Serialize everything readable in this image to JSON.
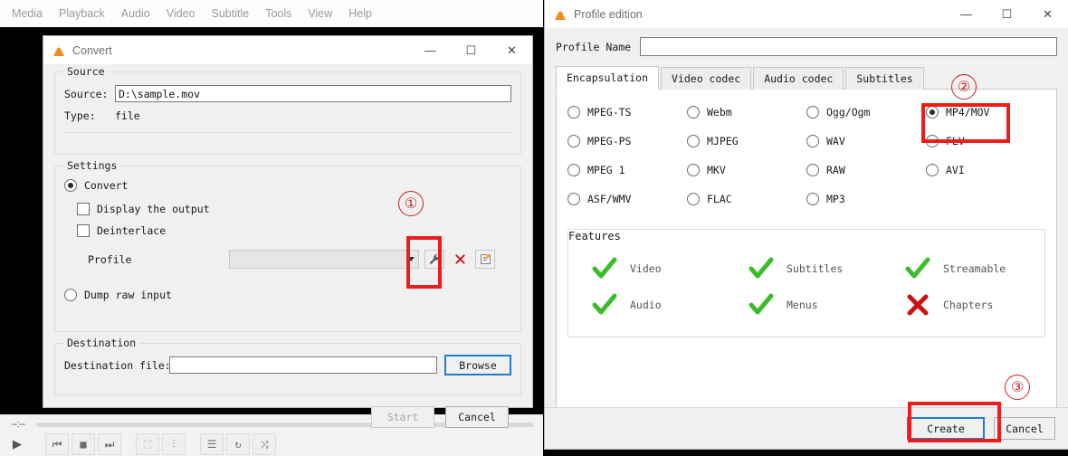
{
  "vlc": {
    "menu": [
      "Media",
      "Playback",
      "Audio",
      "Video",
      "Subtitle",
      "Tools",
      "View",
      "Help"
    ],
    "time_elapsed": "--:--",
    "controls": [
      {
        "name": "play-button",
        "glyph": "▶"
      },
      {
        "name": "previous-button",
        "glyph": "⏮"
      },
      {
        "name": "stop-button",
        "glyph": "■"
      },
      {
        "name": "next-button",
        "glyph": "⏭"
      },
      {
        "name": "fullscreen-button",
        "glyph": "⛶"
      },
      {
        "name": "extended-settings-button",
        "glyph": "⫶"
      },
      {
        "name": "playlist-button",
        "glyph": "☰"
      },
      {
        "name": "loop-button",
        "glyph": "↻"
      },
      {
        "name": "shuffle-button",
        "glyph": "⤨"
      }
    ]
  },
  "convert": {
    "title": "Convert",
    "minimize": "—",
    "maximize": "☐",
    "close": "✕",
    "source": {
      "legend": "Source",
      "source_label": "Source:",
      "source_value": "D:\\sample.mov",
      "type_label": "Type:",
      "type_value": "file"
    },
    "settings": {
      "legend": "Settings",
      "convert_label": "Convert",
      "display_output_label": "Display the output",
      "deinterlace_label": "Deinterlace",
      "profile_label": "Profile",
      "profile_value": "",
      "dump_raw_label": "Dump raw input",
      "edit_profile_icon": "wrench-icon",
      "delete_profile_icon": "delete-x-icon",
      "new_profile_icon": "new-profile-icon"
    },
    "destination": {
      "legend": "Destination",
      "file_label": "Destination file:",
      "file_value": "",
      "browse_label": "Browse"
    },
    "footer": {
      "start_label": "Start",
      "cancel_label": "Cancel"
    }
  },
  "profile": {
    "title": "Profile edition",
    "minimize": "—",
    "maximize": "☐",
    "close": "✕",
    "name_label": "Profile Name",
    "name_value": "",
    "tabs": [
      {
        "label": "Encapsulation",
        "active": true
      },
      {
        "label": "Video codec",
        "active": false
      },
      {
        "label": "Audio codec",
        "active": false
      },
      {
        "label": "Subtitles",
        "active": false
      }
    ],
    "encapsulations": [
      {
        "label": "MPEG-TS",
        "selected": false
      },
      {
        "label": "Webm",
        "selected": false
      },
      {
        "label": "Ogg/Ogm",
        "selected": false
      },
      {
        "label": "MP4/MOV",
        "selected": true
      },
      {
        "label": "MPEG-PS",
        "selected": false
      },
      {
        "label": "MJPEG",
        "selected": false
      },
      {
        "label": "WAV",
        "selected": false
      },
      {
        "label": "FLV",
        "selected": false
      },
      {
        "label": "MPEG 1",
        "selected": false
      },
      {
        "label": "MKV",
        "selected": false
      },
      {
        "label": "RAW",
        "selected": false
      },
      {
        "label": "AVI",
        "selected": false
      },
      {
        "label": "ASF/WMV",
        "selected": false
      },
      {
        "label": "FLAC",
        "selected": false
      },
      {
        "label": "MP3",
        "selected": false
      },
      {
        "label": "",
        "selected": false
      }
    ],
    "features": {
      "legend": "Features",
      "items": [
        {
          "label": "Video",
          "state": "yes"
        },
        {
          "label": "Subtitles",
          "state": "yes"
        },
        {
          "label": "Streamable",
          "state": "yes"
        },
        {
          "label": "Audio",
          "state": "yes"
        },
        {
          "label": "Menus",
          "state": "yes"
        },
        {
          "label": "Chapters",
          "state": "no"
        }
      ]
    },
    "footer": {
      "create_label": "Create",
      "cancel_label": "Cancel"
    }
  },
  "annotations": [
    {
      "number": "①",
      "target": "profile-edit-wrench-button"
    },
    {
      "number": "②",
      "target": "encapsulation-mp4-mov-radio"
    },
    {
      "number": "③",
      "target": "create-button"
    }
  ],
  "colors": {
    "annotation_red": "#ee1c1c",
    "annotation_number_red": "#cc2020",
    "focus_blue": "#1f7cd6",
    "check_green": "#3bbd2b",
    "cross_red": "#cc1111",
    "vlc_orange": "#f08a1a"
  }
}
